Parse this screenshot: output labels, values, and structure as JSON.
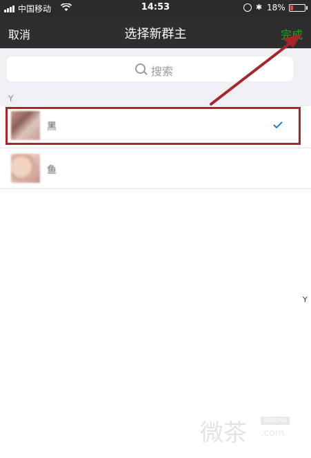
{
  "status_bar": {
    "carrier": "中国移动",
    "time": "14:53",
    "battery_percent": "18%",
    "battery_level": 0.18
  },
  "nav": {
    "cancel_label": "取消",
    "title": "选择新群主",
    "done_label": "完成",
    "done_color": "#1aad19"
  },
  "search": {
    "placeholder": "搜索"
  },
  "list": {
    "section_letter": "Y",
    "items": [
      {
        "name": "黑",
        "selected": true
      },
      {
        "name": "鱼",
        "selected": false
      }
    ]
  },
  "index_bar": {
    "letter": "Y"
  },
  "annotation": {
    "color": "#a5272b"
  },
  "watermark": {
    "text": "微茶",
    "badge": "WXCHA",
    "url": ".com"
  }
}
